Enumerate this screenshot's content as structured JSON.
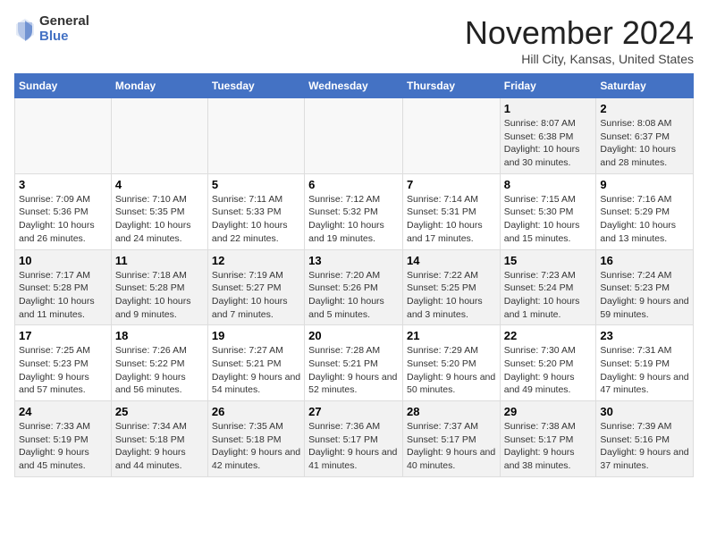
{
  "logo": {
    "general": "General",
    "blue": "Blue"
  },
  "title": "November 2024",
  "location": "Hill City, Kansas, United States",
  "weekdays": [
    "Sunday",
    "Monday",
    "Tuesday",
    "Wednesday",
    "Thursday",
    "Friday",
    "Saturday"
  ],
  "rows": [
    [
      {
        "day": "",
        "sunrise": "",
        "sunset": "",
        "daylight": ""
      },
      {
        "day": "",
        "sunrise": "",
        "sunset": "",
        "daylight": ""
      },
      {
        "day": "",
        "sunrise": "",
        "sunset": "",
        "daylight": ""
      },
      {
        "day": "",
        "sunrise": "",
        "sunset": "",
        "daylight": ""
      },
      {
        "day": "",
        "sunrise": "",
        "sunset": "",
        "daylight": ""
      },
      {
        "day": "1",
        "sunrise": "Sunrise: 8:07 AM",
        "sunset": "Sunset: 6:38 PM",
        "daylight": "Daylight: 10 hours and 30 minutes."
      },
      {
        "day": "2",
        "sunrise": "Sunrise: 8:08 AM",
        "sunset": "Sunset: 6:37 PM",
        "daylight": "Daylight: 10 hours and 28 minutes."
      }
    ],
    [
      {
        "day": "3",
        "sunrise": "Sunrise: 7:09 AM",
        "sunset": "Sunset: 5:36 PM",
        "daylight": "Daylight: 10 hours and 26 minutes."
      },
      {
        "day": "4",
        "sunrise": "Sunrise: 7:10 AM",
        "sunset": "Sunset: 5:35 PM",
        "daylight": "Daylight: 10 hours and 24 minutes."
      },
      {
        "day": "5",
        "sunrise": "Sunrise: 7:11 AM",
        "sunset": "Sunset: 5:33 PM",
        "daylight": "Daylight: 10 hours and 22 minutes."
      },
      {
        "day": "6",
        "sunrise": "Sunrise: 7:12 AM",
        "sunset": "Sunset: 5:32 PM",
        "daylight": "Daylight: 10 hours and 19 minutes."
      },
      {
        "day": "7",
        "sunrise": "Sunrise: 7:14 AM",
        "sunset": "Sunset: 5:31 PM",
        "daylight": "Daylight: 10 hours and 17 minutes."
      },
      {
        "day": "8",
        "sunrise": "Sunrise: 7:15 AM",
        "sunset": "Sunset: 5:30 PM",
        "daylight": "Daylight: 10 hours and 15 minutes."
      },
      {
        "day": "9",
        "sunrise": "Sunrise: 7:16 AM",
        "sunset": "Sunset: 5:29 PM",
        "daylight": "Daylight: 10 hours and 13 minutes."
      }
    ],
    [
      {
        "day": "10",
        "sunrise": "Sunrise: 7:17 AM",
        "sunset": "Sunset: 5:28 PM",
        "daylight": "Daylight: 10 hours and 11 minutes."
      },
      {
        "day": "11",
        "sunrise": "Sunrise: 7:18 AM",
        "sunset": "Sunset: 5:28 PM",
        "daylight": "Daylight: 10 hours and 9 minutes."
      },
      {
        "day": "12",
        "sunrise": "Sunrise: 7:19 AM",
        "sunset": "Sunset: 5:27 PM",
        "daylight": "Daylight: 10 hours and 7 minutes."
      },
      {
        "day": "13",
        "sunrise": "Sunrise: 7:20 AM",
        "sunset": "Sunset: 5:26 PM",
        "daylight": "Daylight: 10 hours and 5 minutes."
      },
      {
        "day": "14",
        "sunrise": "Sunrise: 7:22 AM",
        "sunset": "Sunset: 5:25 PM",
        "daylight": "Daylight: 10 hours and 3 minutes."
      },
      {
        "day": "15",
        "sunrise": "Sunrise: 7:23 AM",
        "sunset": "Sunset: 5:24 PM",
        "daylight": "Daylight: 10 hours and 1 minute."
      },
      {
        "day": "16",
        "sunrise": "Sunrise: 7:24 AM",
        "sunset": "Sunset: 5:23 PM",
        "daylight": "Daylight: 9 hours and 59 minutes."
      }
    ],
    [
      {
        "day": "17",
        "sunrise": "Sunrise: 7:25 AM",
        "sunset": "Sunset: 5:23 PM",
        "daylight": "Daylight: 9 hours and 57 minutes."
      },
      {
        "day": "18",
        "sunrise": "Sunrise: 7:26 AM",
        "sunset": "Sunset: 5:22 PM",
        "daylight": "Daylight: 9 hours and 56 minutes."
      },
      {
        "day": "19",
        "sunrise": "Sunrise: 7:27 AM",
        "sunset": "Sunset: 5:21 PM",
        "daylight": "Daylight: 9 hours and 54 minutes."
      },
      {
        "day": "20",
        "sunrise": "Sunrise: 7:28 AM",
        "sunset": "Sunset: 5:21 PM",
        "daylight": "Daylight: 9 hours and 52 minutes."
      },
      {
        "day": "21",
        "sunrise": "Sunrise: 7:29 AM",
        "sunset": "Sunset: 5:20 PM",
        "daylight": "Daylight: 9 hours and 50 minutes."
      },
      {
        "day": "22",
        "sunrise": "Sunrise: 7:30 AM",
        "sunset": "Sunset: 5:20 PM",
        "daylight": "Daylight: 9 hours and 49 minutes."
      },
      {
        "day": "23",
        "sunrise": "Sunrise: 7:31 AM",
        "sunset": "Sunset: 5:19 PM",
        "daylight": "Daylight: 9 hours and 47 minutes."
      }
    ],
    [
      {
        "day": "24",
        "sunrise": "Sunrise: 7:33 AM",
        "sunset": "Sunset: 5:19 PM",
        "daylight": "Daylight: 9 hours and 45 minutes."
      },
      {
        "day": "25",
        "sunrise": "Sunrise: 7:34 AM",
        "sunset": "Sunset: 5:18 PM",
        "daylight": "Daylight: 9 hours and 44 minutes."
      },
      {
        "day": "26",
        "sunrise": "Sunrise: 7:35 AM",
        "sunset": "Sunset: 5:18 PM",
        "daylight": "Daylight: 9 hours and 42 minutes."
      },
      {
        "day": "27",
        "sunrise": "Sunrise: 7:36 AM",
        "sunset": "Sunset: 5:17 PM",
        "daylight": "Daylight: 9 hours and 41 minutes."
      },
      {
        "day": "28",
        "sunrise": "Sunrise: 7:37 AM",
        "sunset": "Sunset: 5:17 PM",
        "daylight": "Daylight: 9 hours and 40 minutes."
      },
      {
        "day": "29",
        "sunrise": "Sunrise: 7:38 AM",
        "sunset": "Sunset: 5:17 PM",
        "daylight": "Daylight: 9 hours and 38 minutes."
      },
      {
        "day": "30",
        "sunrise": "Sunrise: 7:39 AM",
        "sunset": "Sunset: 5:16 PM",
        "daylight": "Daylight: 9 hours and 37 minutes."
      }
    ]
  ]
}
